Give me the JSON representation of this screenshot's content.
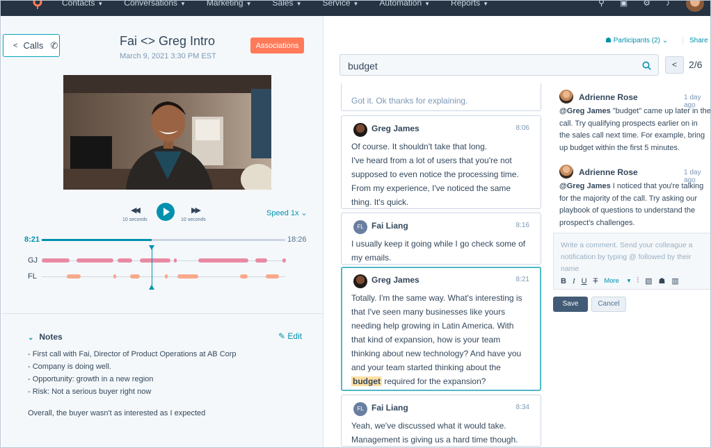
{
  "nav": {
    "items": [
      "Contacts",
      "Conversations",
      "Marketing",
      "Sales",
      "Service",
      "Automation",
      "Reports"
    ],
    "icons": [
      "search-icon",
      "help-icon",
      "settings-icon",
      "notifications-icon"
    ]
  },
  "header": {
    "back_label": "Calls",
    "title": "Fai <> Greg Intro",
    "date": "March 9, 2021 3:30 PM EST",
    "associations_label": "Associations"
  },
  "player": {
    "rewind_label": "10 seconds",
    "forward_label": "10 seconds",
    "speed_label": "Speed 1x",
    "current_time": "8:21",
    "total_time": "18:26",
    "progress": 0.45,
    "tracks": [
      {
        "label": "GJ",
        "color": "#e98aa5"
      },
      {
        "label": "FL",
        "color": "#f8a98c"
      }
    ]
  },
  "notes": {
    "title": "Notes",
    "edit_label": "Edit",
    "lines": [
      "- First call with Fai, Director of Product Operations at AB Corp",
      "- Company is doing well.",
      "- Opportunity: growth in a new region",
      "- Risk: Not a serious buyer right now"
    ],
    "summary": "Overall, the buyer wasn't as interested as I expected"
  },
  "toolbar_right": {
    "participants_label": "Participants (2)",
    "share_label": "Share"
  },
  "search": {
    "value": "budget",
    "pager": "2/6"
  },
  "transcript": [
    {
      "speaker": "",
      "time": "",
      "initials": "",
      "lines": [
        "Got it. Ok thanks for explaining."
      ]
    },
    {
      "speaker": "Greg James",
      "time": "8:06",
      "initials": "",
      "lines": [
        "Of course. It shouldn't take that long.",
        "I've heard from a lot of users that you're not",
        "supposed to even notice the processing time.",
        "From my experience, I've noticed the same",
        "thing. It's quick."
      ]
    },
    {
      "speaker": "Fai Liang",
      "time": "8:16",
      "initials": "FL",
      "lines": [
        "I usually keep it going while I go check some of",
        "my emails."
      ]
    },
    {
      "speaker": "Greg James",
      "time": "8:21",
      "initials": "",
      "lines": [
        "Totally. I'm the same way. What's interesting is",
        "that I've seen many businesses like yours",
        "needing help growing in Latin America. With",
        "that kind of expansion, how is your team",
        "thinking about new technology? And have you",
        "and your team started thinking about the"
      ],
      "highlight": "budget",
      "last_line": " required for the expansion?"
    },
    {
      "speaker": "Fai Liang",
      "time": "8:34",
      "initials": "FL",
      "lines": [
        "Yeah, we've discussed what it would take.",
        "Management is giving us a hard time though."
      ]
    }
  ],
  "comments": [
    {
      "author": "Adrienne Rose",
      "time": "1 day ago",
      "mention": "@Greg James",
      "lines": [
        " \"budget\" came up later in the",
        "call. Try qualifying prospects earlier on in",
        "the sales call next time. For example, bring",
        "up budget within the first 5 minutes."
      ]
    },
    {
      "author": "Adrienne Rose",
      "time": "1 day ago",
      "mention": "@Greg James",
      "lines": [
        " I noticed that you're talking",
        "for the majority of the call. Try asking our",
        "playbook of questions to understand the",
        "prospect's challenges."
      ]
    }
  ],
  "comment_box": {
    "placeholder_lines": [
      "Write a comment. Send your colleague a",
      "notification by typing @ followed by their",
      "name"
    ],
    "bold": "B",
    "italic": "I",
    "underline": "U",
    "strike": "T",
    "more_label": "More",
    "save_label": "Save",
    "cancel_label": "Cancel"
  },
  "colors": {
    "accent": "#0091ae",
    "orange": "#ff7a59",
    "nav_bg": "#253342",
    "highlight": "#fde0a5"
  }
}
